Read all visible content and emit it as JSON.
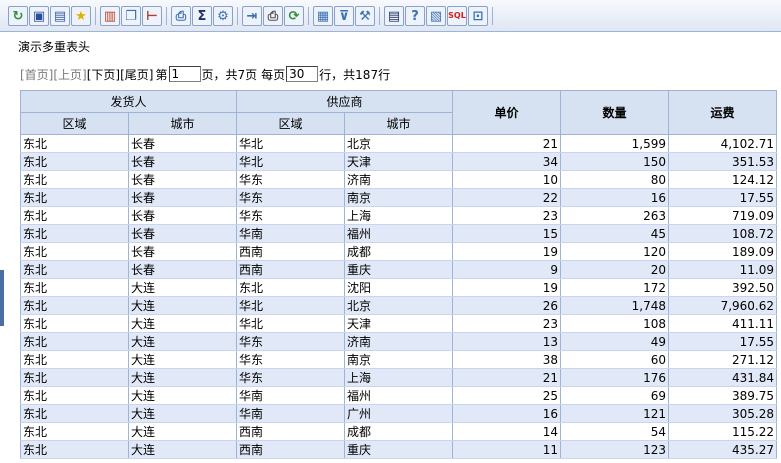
{
  "toolbar": {
    "buttons": [
      {
        "name": "refresh-icon",
        "color": "#2f8f3a",
        "glyph": "↻"
      },
      {
        "name": "save-icon",
        "color": "#2a4f9a",
        "glyph": "▣"
      },
      {
        "name": "save-as-icon",
        "color": "#3a5fa8",
        "glyph": "▤"
      },
      {
        "name": "favorite-icon",
        "color": "#e0b000",
        "glyph": "★"
      },
      {
        "name": "chart-icon",
        "color": "#c04020",
        "glyph": "▥"
      },
      {
        "name": "window-icon",
        "color": "#3a6fb0",
        "glyph": "❐"
      },
      {
        "name": "tree-icon",
        "color": "#b04030",
        "glyph": "⊢"
      },
      {
        "name": "print-preview-icon",
        "color": "#3a6fb0",
        "glyph": "⎙"
      },
      {
        "name": "sum-icon",
        "color": "#203060",
        "glyph": "Σ"
      },
      {
        "name": "settings-icon",
        "color": "#3a6fb0",
        "glyph": "⚙"
      },
      {
        "name": "export-icon",
        "color": "#3a6fb0",
        "glyph": "⇥"
      },
      {
        "name": "print-icon",
        "color": "#505050",
        "glyph": "⎙"
      },
      {
        "name": "sync-icon",
        "color": "#2f8f3a",
        "glyph": "⟳"
      },
      {
        "name": "data-icon",
        "color": "#3a6fb0",
        "glyph": "▦"
      },
      {
        "name": "filter-icon",
        "color": "#3a6fb0",
        "glyph": "⊽"
      },
      {
        "name": "tools-icon",
        "color": "#3a6fb0",
        "glyph": "⚒"
      },
      {
        "name": "grid-icon",
        "color": "#203060",
        "glyph": "▤"
      },
      {
        "name": "help-icon",
        "color": "#3a6fb0",
        "glyph": "?"
      },
      {
        "name": "report-icon",
        "color": "#3a6fb0",
        "glyph": "▧"
      },
      {
        "name": "sql-icon",
        "color": "#d02020",
        "glyph": "SQL"
      },
      {
        "name": "exit-icon",
        "color": "#3a6fb0",
        "glyph": "⊡"
      }
    ]
  },
  "title": "演示多重表头",
  "pager": {
    "first": "[首页]",
    "prev": "[上页]",
    "next": "[下页]",
    "last": "[尾页]",
    "page_prefix": "第",
    "page_value": "1",
    "page_suffix": "页，共7页",
    "per_page_prefix": "每页",
    "per_page_value": "30",
    "total_text": "行，共187行"
  },
  "table": {
    "group_headers": {
      "sender": "发货人",
      "supplier": "供应商"
    },
    "sub_headers": {
      "sender_region": "区域",
      "sender_city": "城市",
      "supplier_region": "区域",
      "supplier_city": "城市"
    },
    "headers": {
      "price": "单价",
      "qty": "数量",
      "freight": "运费"
    },
    "rows": [
      [
        "东北",
        "长春",
        "华北",
        "北京",
        "21",
        "1,599",
        "4,102.71"
      ],
      [
        "东北",
        "长春",
        "华北",
        "天津",
        "34",
        "150",
        "351.53"
      ],
      [
        "东北",
        "长春",
        "华东",
        "济南",
        "10",
        "80",
        "124.12"
      ],
      [
        "东北",
        "长春",
        "华东",
        "南京",
        "22",
        "16",
        "17.55"
      ],
      [
        "东北",
        "长春",
        "华东",
        "上海",
        "23",
        "263",
        "719.09"
      ],
      [
        "东北",
        "长春",
        "华南",
        "福州",
        "15",
        "45",
        "108.72"
      ],
      [
        "东北",
        "长春",
        "西南",
        "成都",
        "19",
        "120",
        "189.09"
      ],
      [
        "东北",
        "长春",
        "西南",
        "重庆",
        "9",
        "20",
        "11.09"
      ],
      [
        "东北",
        "大连",
        "东北",
        "沈阳",
        "19",
        "172",
        "392.50"
      ],
      [
        "东北",
        "大连",
        "华北",
        "北京",
        "26",
        "1,748",
        "7,960.62"
      ],
      [
        "东北",
        "大连",
        "华北",
        "天津",
        "23",
        "108",
        "411.11"
      ],
      [
        "东北",
        "大连",
        "华东",
        "济南",
        "13",
        "49",
        "17.55"
      ],
      [
        "东北",
        "大连",
        "华东",
        "南京",
        "38",
        "60",
        "271.12"
      ],
      [
        "东北",
        "大连",
        "华东",
        "上海",
        "21",
        "176",
        "431.84"
      ],
      [
        "东北",
        "大连",
        "华南",
        "福州",
        "25",
        "69",
        "389.75"
      ],
      [
        "东北",
        "大连",
        "华南",
        "广州",
        "16",
        "121",
        "305.28"
      ],
      [
        "东北",
        "大连",
        "西南",
        "成都",
        "14",
        "54",
        "115.22"
      ],
      [
        "东北",
        "大连",
        "西南",
        "重庆",
        "11",
        "123",
        "435.27"
      ]
    ]
  }
}
